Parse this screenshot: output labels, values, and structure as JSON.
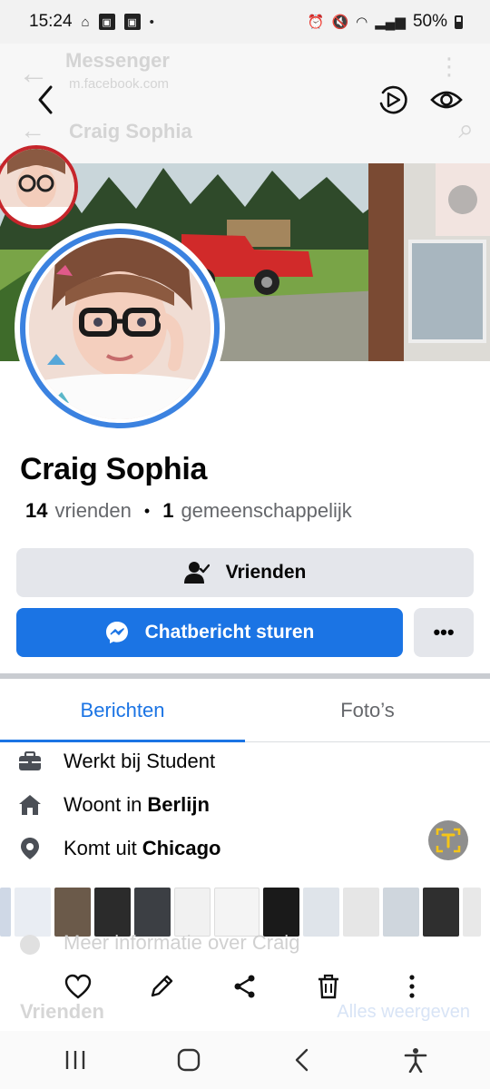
{
  "status_bar": {
    "time": "15:24",
    "battery": "50%"
  },
  "browser_overlay": {
    "title": "Messenger",
    "url": "m.facebook.com",
    "page_title": "Craig Sophia"
  },
  "profile": {
    "name": "Craig Sophia",
    "friends_count": "14",
    "friends_label": "vrienden",
    "mutual_count": "1",
    "mutual_label": "gemeenschappelijk"
  },
  "buttons": {
    "friends": "Vrienden",
    "message": "Chatbericht sturen",
    "more": "•••"
  },
  "tabs": [
    {
      "label": "Berichten",
      "active": true
    },
    {
      "label": "Foto’s",
      "active": false
    }
  ],
  "info": {
    "work": {
      "prefix": "Werkt bij Student",
      "value": ""
    },
    "lives": {
      "prefix": "Woont in",
      "value": "Berlijn"
    },
    "from": {
      "prefix": "Komt uit",
      "value": "Chicago"
    },
    "more": "Meer informatie over Craig"
  },
  "friends_section": {
    "title": "Vrienden",
    "see_all": "Alles weergeven"
  },
  "colors": {
    "accent": "#1b74e4",
    "avatar_ring": "#3b82e0",
    "button_gray": "#e4e6eb"
  },
  "icons": {
    "nav_back": "chevron-left-icon",
    "nav_video": "video-play-icon",
    "nav_eye": "eye-icon",
    "work": "briefcase-icon",
    "lives": "home-icon",
    "from": "location-pin-icon",
    "translate": "text-scan-icon"
  }
}
